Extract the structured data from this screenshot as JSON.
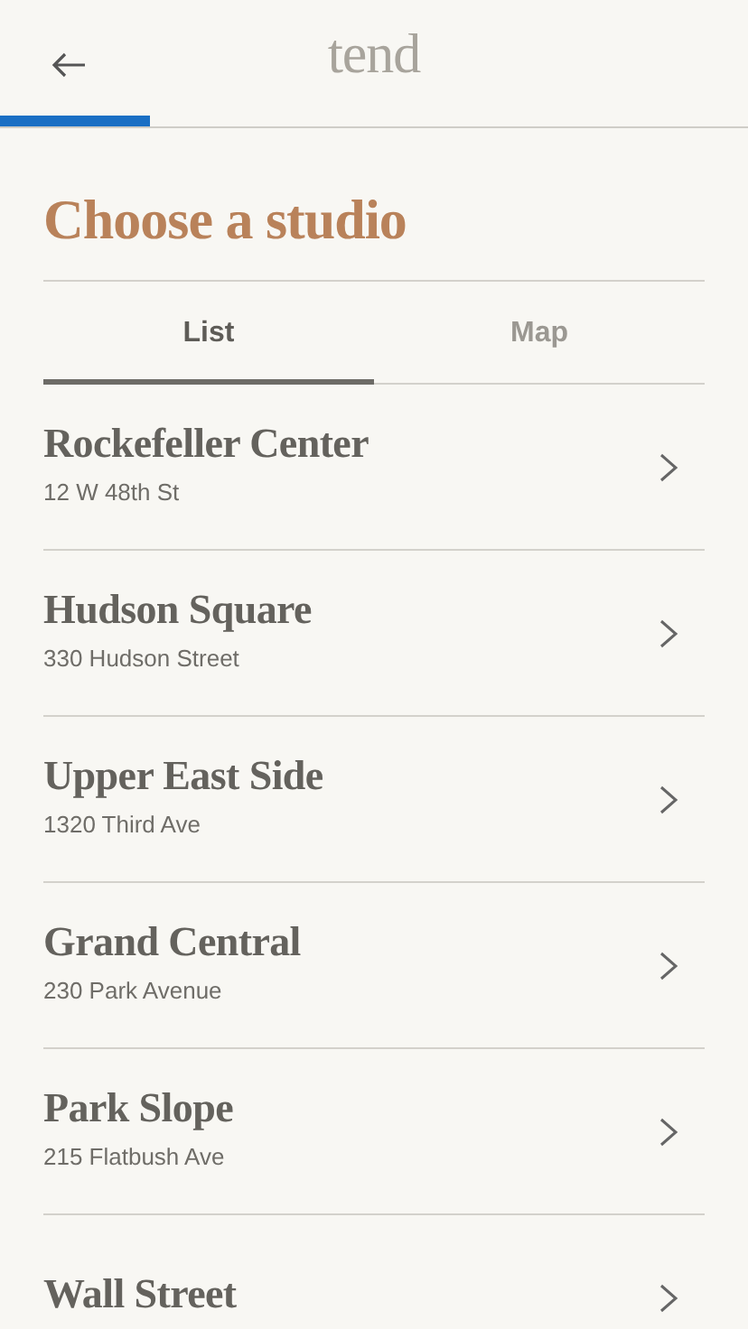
{
  "header": {
    "logo": "tend",
    "progress": {
      "level": 0.2
    }
  },
  "title": "Choose a studio",
  "tabs": [
    {
      "label": "List",
      "selected": true
    },
    {
      "label": "Map",
      "selected": false
    }
  ],
  "studios": [
    {
      "name": "Rockefeller Center",
      "address": "12 W 48th St"
    },
    {
      "name": "Hudson Square",
      "address": "330 Hudson Street"
    },
    {
      "name": "Upper East Side",
      "address": "1320 Third Ave"
    },
    {
      "name": "Grand Central",
      "address": "230 Park Avenue"
    },
    {
      "name": "Park Slope",
      "address": "215 Flatbush Ave"
    },
    {
      "name": "Wall Street"
    }
  ]
}
